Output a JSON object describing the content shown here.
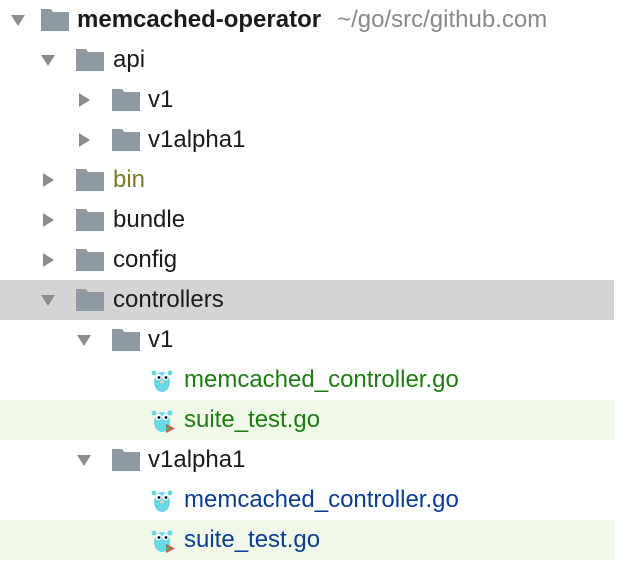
{
  "project_tree": {
    "root": {
      "name": "memcached-operator",
      "path": "~/go/src/github.com"
    },
    "nodes": [
      {
        "label": "api",
        "type": "folder",
        "expanded": true
      },
      {
        "label": "v1",
        "type": "folder",
        "expanded": false
      },
      {
        "label": "v1alpha1",
        "type": "folder",
        "expanded": false
      },
      {
        "label": "bin",
        "type": "folder",
        "expanded": false,
        "status": "excluded"
      },
      {
        "label": "bundle",
        "type": "folder",
        "expanded": false
      },
      {
        "label": "config",
        "type": "folder",
        "expanded": false
      },
      {
        "label": "controllers",
        "type": "folder",
        "expanded": true,
        "selected": true
      },
      {
        "label": "v1",
        "type": "folder",
        "expanded": true
      },
      {
        "label": "memcached_controller.go",
        "type": "go-file",
        "status": "added"
      },
      {
        "label": "suite_test.go",
        "type": "go-test-file",
        "status": "added"
      },
      {
        "label": "v1alpha1",
        "type": "folder",
        "expanded": true
      },
      {
        "label": "memcached_controller.go",
        "type": "go-file",
        "status": "modified"
      },
      {
        "label": "suite_test.go",
        "type": "go-test-file",
        "status": "modified"
      }
    ]
  },
  "colors": {
    "added": "#1e7d12",
    "modified": "#0b3d91",
    "excluded": "#7a7a2a",
    "selection": "#d4d4d4",
    "changed_row": "#f0f8e8",
    "folder_icon": "#8e9aa1"
  },
  "icons": {
    "expanded": "triangle-down-icon",
    "collapsed": "triangle-right-icon",
    "folder": "folder-icon",
    "go_file": "gopher-icon",
    "go_test_file": "gopher-test-icon"
  }
}
